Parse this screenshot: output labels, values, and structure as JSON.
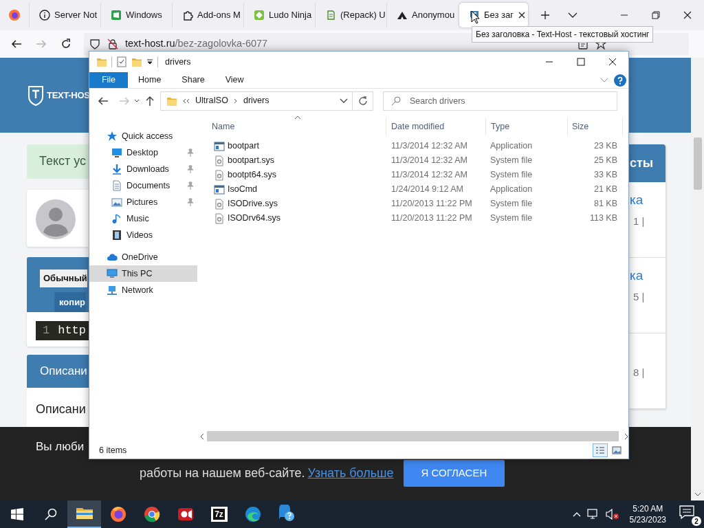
{
  "browser": {
    "tabs": [
      {
        "label": "Server Not",
        "kind": "info",
        "selected": false
      },
      {
        "label": "Windows",
        "kind": "windows",
        "selected": false
      },
      {
        "label": "Add-ons M",
        "kind": "puzzle",
        "selected": false
      },
      {
        "label": "Ludo Ninja",
        "kind": "game",
        "selected": false
      },
      {
        "label": "(Repack) U",
        "kind": "repack",
        "selected": false
      },
      {
        "label": "Anonymou",
        "kind": "anon",
        "selected": false
      },
      {
        "label": "Без заг",
        "kind": "texthost",
        "selected": true
      }
    ],
    "tooltip": "Без заголовка - Text-Host - текстовый хостинг",
    "url_host": "text-host.ru",
    "url_path": "/bez-zagolovka-6077"
  },
  "page": {
    "logo": "TEXT-HOS",
    "alert": "Текст ус",
    "badge": "Обычный",
    "copy_button": "копир",
    "code_line_number": "1",
    "code": "http",
    "section_header": "Описани",
    "section_text": "Описани",
    "sidebar_header": "сты",
    "sidebar_items": [
      {
        "link": "ка",
        "meta": "1 |"
      },
      {
        "link": "ка",
        "meta": "5 |"
      },
      {
        "meta": "8 |"
      }
    ]
  },
  "cookie": {
    "text_start": "Вы люби",
    "text": "работы на нашем веб-сайте.",
    "link": "Узнать больше",
    "button": "Я СОГЛАСЕН"
  },
  "explorer": {
    "title": "drivers",
    "ribbon_tabs": [
      {
        "label": "File",
        "selected": true
      },
      {
        "label": "Home",
        "selected": false
      },
      {
        "label": "Share",
        "selected": false
      },
      {
        "label": "View",
        "selected": false
      }
    ],
    "breadcrumb": [
      "UltraISO",
      "drivers"
    ],
    "search_placeholder": "Search drivers",
    "columns": [
      "Name",
      "Date modified",
      "Type",
      "Size"
    ],
    "nav": [
      {
        "label": "Quick access",
        "kind": "star",
        "selected": false,
        "children": [
          {
            "label": "Desktop",
            "kind": "desktop",
            "pinned": true,
            "selected": false
          },
          {
            "label": "Downloads",
            "kind": "download",
            "pinned": true,
            "selected": false
          },
          {
            "label": "Documents",
            "kind": "document",
            "pinned": true,
            "selected": false
          },
          {
            "label": "Pictures",
            "kind": "pictures",
            "pinned": true,
            "selected": false
          },
          {
            "label": "Music",
            "kind": "music",
            "pinned": false,
            "selected": false
          },
          {
            "label": "Videos",
            "kind": "video",
            "pinned": false,
            "selected": false
          }
        ]
      },
      {
        "label": "OneDrive",
        "kind": "cloud",
        "selected": false
      },
      {
        "label": "This PC",
        "kind": "pc",
        "selected": true
      },
      {
        "label": "Network",
        "kind": "network",
        "selected": false
      }
    ],
    "files": [
      {
        "name": "bootpart",
        "date": "11/3/2014 12:32 AM",
        "type": "Application",
        "size": "23 KB",
        "kind": "app"
      },
      {
        "name": "bootpart.sys",
        "date": "11/3/2014 12:32 AM",
        "type": "System file",
        "size": "25 KB",
        "kind": "sys"
      },
      {
        "name": "bootpt64.sys",
        "date": "11/3/2014 12:32 AM",
        "type": "System file",
        "size": "33 KB",
        "kind": "sys"
      },
      {
        "name": "IsoCmd",
        "date": "1/24/2014 9:12 AM",
        "type": "Application",
        "size": "21 KB",
        "kind": "app"
      },
      {
        "name": "ISODrive.sys",
        "date": "11/20/2013 11:22 PM",
        "type": "System file",
        "size": "81 KB",
        "kind": "sys"
      },
      {
        "name": "ISODrv64.sys",
        "date": "11/20/2013 11:22 PM",
        "type": "System file",
        "size": "113 KB",
        "kind": "sys"
      }
    ],
    "status": "6 items"
  },
  "taskbar": {
    "apps": [
      {
        "kind": "folder",
        "selected": true
      },
      {
        "kind": "firefox",
        "selected": false
      },
      {
        "kind": "chrome",
        "selected": false
      },
      {
        "kind": "camera",
        "selected": false
      },
      {
        "kind": "archive",
        "label": "7z",
        "selected": false
      },
      {
        "kind": "edge",
        "selected": false
      },
      {
        "kind": "help",
        "selected": false
      }
    ],
    "time": "5:20 AM",
    "date": "5/23/2023",
    "notifications": "2"
  }
}
